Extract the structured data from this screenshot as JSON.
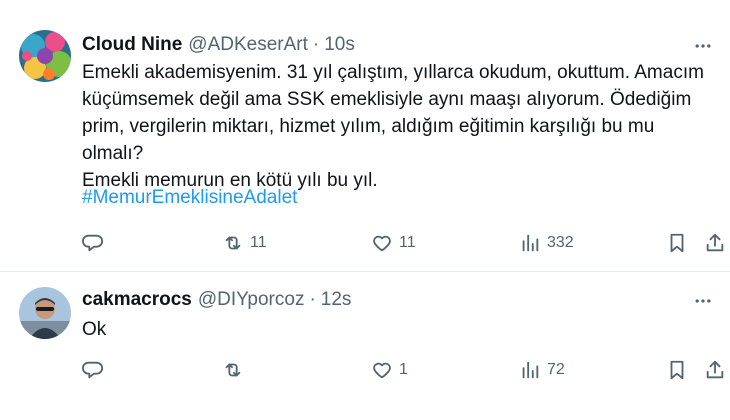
{
  "tweets": [
    {
      "display_name": "Cloud Nine",
      "handle": "@ADKeserArt",
      "separator": "·",
      "time": "10s",
      "text": "Emekli akademisyenim. 31 yıl çalıştım, yıllarca okudum, okuttum. Amacım\nküçümsemek değil ama SSK emeklisiyle aynı maaşı alıyorum. Ödediğim\nprim, vergilerin miktarı, hizmet yılım, aldığım eğitimin karşılığı bu mu olmalı?\nEmekli memurun en kötü yılı bu yıl.",
      "hashtag": "#MemurEmeklisineAdalet",
      "retweets": "11",
      "likes": "11",
      "views": "332",
      "avatar_colors": [
        "#3aa7c8",
        "#e94f8a",
        "#7bc043",
        "#f6c445"
      ]
    },
    {
      "display_name": "cakmacrocs",
      "handle": "@DIYporcoz",
      "separator": "·",
      "time": "12s",
      "text": "Ok",
      "retweets": "",
      "likes": "1",
      "views": "72",
      "avatar_colors": [
        "#a9c4dd",
        "#2d3a4a",
        "#c99a7a"
      ]
    }
  ],
  "icons": {
    "more": "more-horizontal-icon",
    "reply": "reply-icon",
    "retweet": "retweet-icon",
    "like": "heart-icon",
    "views": "views-icon",
    "bookmark": "bookmark-icon",
    "share": "share-icon"
  },
  "colors": {
    "text": "#0f1419",
    "secondary": "#536471",
    "link": "#1d9bf0",
    "divider": "#e6ecf0"
  }
}
